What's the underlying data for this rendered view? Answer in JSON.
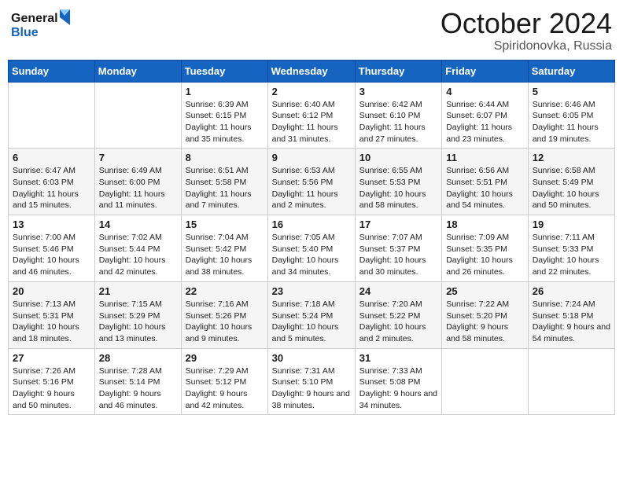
{
  "header": {
    "logo_line1": "General",
    "logo_line2": "Blue",
    "month_title": "October 2024",
    "location": "Spiridonovka, Russia"
  },
  "weekdays": [
    "Sunday",
    "Monday",
    "Tuesday",
    "Wednesday",
    "Thursday",
    "Friday",
    "Saturday"
  ],
  "weeks": [
    [
      {
        "day": "",
        "info": ""
      },
      {
        "day": "",
        "info": ""
      },
      {
        "day": "1",
        "info": "Sunrise: 6:39 AM\nSunset: 6:15 PM\nDaylight: 11 hours and 35 minutes."
      },
      {
        "day": "2",
        "info": "Sunrise: 6:40 AM\nSunset: 6:12 PM\nDaylight: 11 hours and 31 minutes."
      },
      {
        "day": "3",
        "info": "Sunrise: 6:42 AM\nSunset: 6:10 PM\nDaylight: 11 hours and 27 minutes."
      },
      {
        "day": "4",
        "info": "Sunrise: 6:44 AM\nSunset: 6:07 PM\nDaylight: 11 hours and 23 minutes."
      },
      {
        "day": "5",
        "info": "Sunrise: 6:46 AM\nSunset: 6:05 PM\nDaylight: 11 hours and 19 minutes."
      }
    ],
    [
      {
        "day": "6",
        "info": "Sunrise: 6:47 AM\nSunset: 6:03 PM\nDaylight: 11 hours and 15 minutes."
      },
      {
        "day": "7",
        "info": "Sunrise: 6:49 AM\nSunset: 6:00 PM\nDaylight: 11 hours and 11 minutes."
      },
      {
        "day": "8",
        "info": "Sunrise: 6:51 AM\nSunset: 5:58 PM\nDaylight: 11 hours and 7 minutes."
      },
      {
        "day": "9",
        "info": "Sunrise: 6:53 AM\nSunset: 5:56 PM\nDaylight: 11 hours and 2 minutes."
      },
      {
        "day": "10",
        "info": "Sunrise: 6:55 AM\nSunset: 5:53 PM\nDaylight: 10 hours and 58 minutes."
      },
      {
        "day": "11",
        "info": "Sunrise: 6:56 AM\nSunset: 5:51 PM\nDaylight: 10 hours and 54 minutes."
      },
      {
        "day": "12",
        "info": "Sunrise: 6:58 AM\nSunset: 5:49 PM\nDaylight: 10 hours and 50 minutes."
      }
    ],
    [
      {
        "day": "13",
        "info": "Sunrise: 7:00 AM\nSunset: 5:46 PM\nDaylight: 10 hours and 46 minutes."
      },
      {
        "day": "14",
        "info": "Sunrise: 7:02 AM\nSunset: 5:44 PM\nDaylight: 10 hours and 42 minutes."
      },
      {
        "day": "15",
        "info": "Sunrise: 7:04 AM\nSunset: 5:42 PM\nDaylight: 10 hours and 38 minutes."
      },
      {
        "day": "16",
        "info": "Sunrise: 7:05 AM\nSunset: 5:40 PM\nDaylight: 10 hours and 34 minutes."
      },
      {
        "day": "17",
        "info": "Sunrise: 7:07 AM\nSunset: 5:37 PM\nDaylight: 10 hours and 30 minutes."
      },
      {
        "day": "18",
        "info": "Sunrise: 7:09 AM\nSunset: 5:35 PM\nDaylight: 10 hours and 26 minutes."
      },
      {
        "day": "19",
        "info": "Sunrise: 7:11 AM\nSunset: 5:33 PM\nDaylight: 10 hours and 22 minutes."
      }
    ],
    [
      {
        "day": "20",
        "info": "Sunrise: 7:13 AM\nSunset: 5:31 PM\nDaylight: 10 hours and 18 minutes."
      },
      {
        "day": "21",
        "info": "Sunrise: 7:15 AM\nSunset: 5:29 PM\nDaylight: 10 hours and 13 minutes."
      },
      {
        "day": "22",
        "info": "Sunrise: 7:16 AM\nSunset: 5:26 PM\nDaylight: 10 hours and 9 minutes."
      },
      {
        "day": "23",
        "info": "Sunrise: 7:18 AM\nSunset: 5:24 PM\nDaylight: 10 hours and 5 minutes."
      },
      {
        "day": "24",
        "info": "Sunrise: 7:20 AM\nSunset: 5:22 PM\nDaylight: 10 hours and 2 minutes."
      },
      {
        "day": "25",
        "info": "Sunrise: 7:22 AM\nSunset: 5:20 PM\nDaylight: 9 hours and 58 minutes."
      },
      {
        "day": "26",
        "info": "Sunrise: 7:24 AM\nSunset: 5:18 PM\nDaylight: 9 hours and 54 minutes."
      }
    ],
    [
      {
        "day": "27",
        "info": "Sunrise: 7:26 AM\nSunset: 5:16 PM\nDaylight: 9 hours and 50 minutes."
      },
      {
        "day": "28",
        "info": "Sunrise: 7:28 AM\nSunset: 5:14 PM\nDaylight: 9 hours and 46 minutes."
      },
      {
        "day": "29",
        "info": "Sunrise: 7:29 AM\nSunset: 5:12 PM\nDaylight: 9 hours and 42 minutes."
      },
      {
        "day": "30",
        "info": "Sunrise: 7:31 AM\nSunset: 5:10 PM\nDaylight: 9 hours and 38 minutes."
      },
      {
        "day": "31",
        "info": "Sunrise: 7:33 AM\nSunset: 5:08 PM\nDaylight: 9 hours and 34 minutes."
      },
      {
        "day": "",
        "info": ""
      },
      {
        "day": "",
        "info": ""
      }
    ]
  ]
}
